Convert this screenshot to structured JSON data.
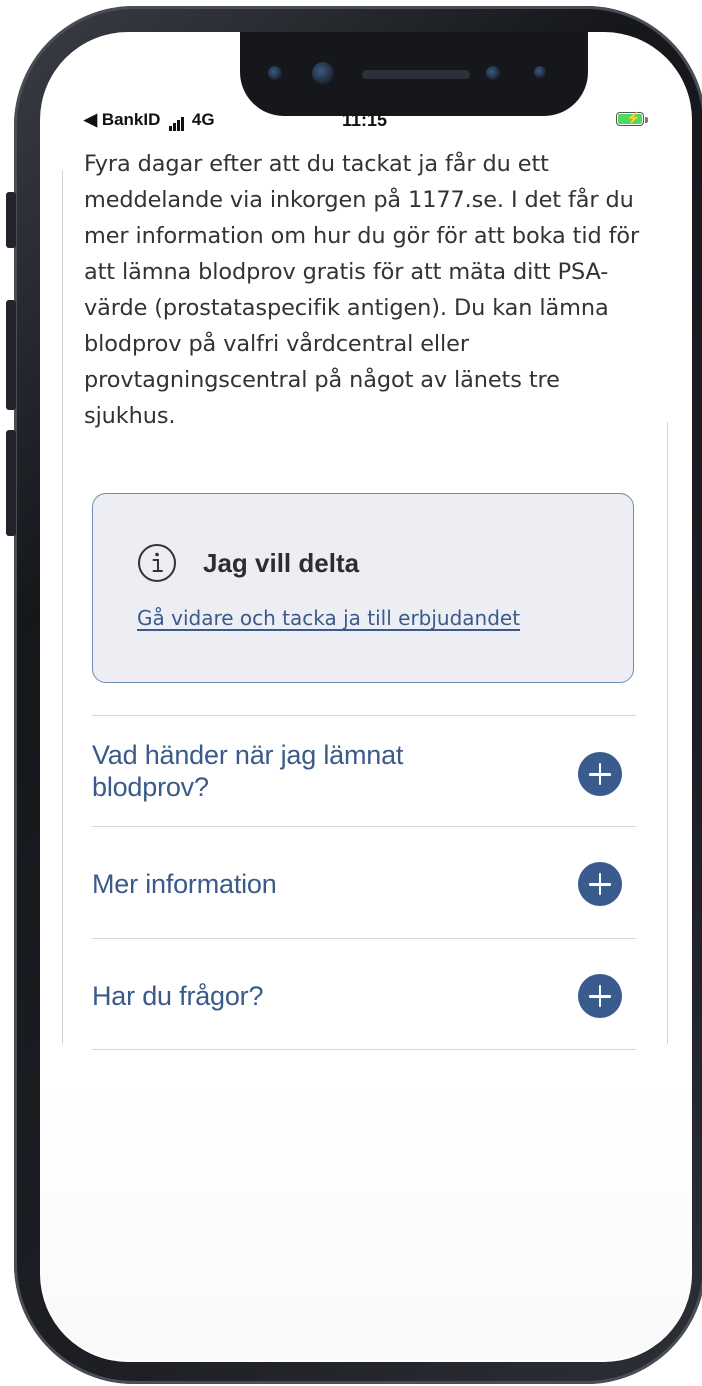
{
  "status_bar": {
    "back_app": "BankID",
    "network": "4G",
    "time": "11:15",
    "battery_charging": true,
    "battery_level": 1.0
  },
  "intro_text": "Fyra dagar efter att du tackat ja får du ett meddelande via inkorgen på 1177.se. I det får du mer information om hur du gör för att boka tid för att lämna blodprov gratis för att mäta ditt PSA-värde (prostataspecifik antigen). Du kan lämna blodprov på valfri vårdcentral eller provtagningscentral på något av länets tre sjukhus.",
  "info_card": {
    "title": "Jag vill delta",
    "link_text": "Gå vidare och tacka ja till erbjudandet",
    "icon": "info-icon"
  },
  "accordion": [
    {
      "title": "Vad händer när jag lämnat blodprov?",
      "icon": "plus-icon"
    },
    {
      "title": "Mer information",
      "icon": "plus-icon"
    },
    {
      "title": "Har du frågor?",
      "icon": "plus-icon"
    }
  ],
  "colors": {
    "accent": "#3a5b8d",
    "card_background": "#eceef4",
    "card_border": "#6f8db0",
    "body_text": "#333333"
  }
}
